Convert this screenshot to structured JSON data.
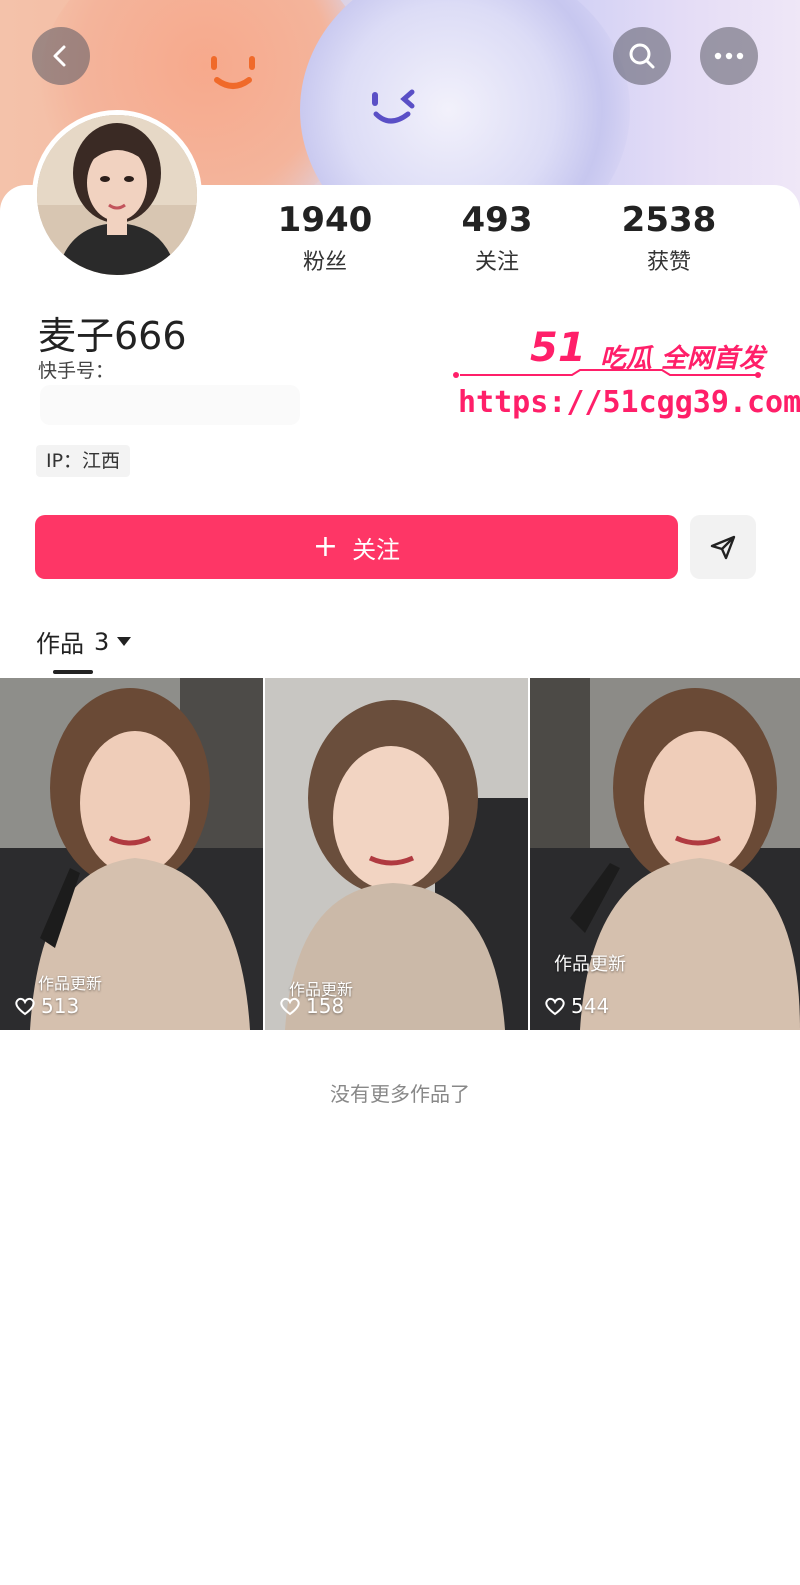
{
  "profile": {
    "nickname": "麦子666",
    "kuaishou_id_label": "快手号",
    "ip_label": "IP：江西"
  },
  "stats": [
    {
      "value": "1940",
      "label": "粉丝"
    },
    {
      "value": "493",
      "label": "关注"
    },
    {
      "value": "2538",
      "label": "获赞"
    }
  ],
  "actions": {
    "follow_label": "关注",
    "follow_icon": "plus-icon",
    "share_icon": "send-icon"
  },
  "header_icons": [
    "back-icon",
    "search-icon",
    "more-icon"
  ],
  "watermark": {
    "brand_number": "51",
    "brand_text": "吃瓜 全网首发",
    "url": "https://51cgg39.com"
  },
  "tabs": {
    "works_label": "作品",
    "works_count": "3"
  },
  "videos": [
    {
      "label": "作品更新",
      "likes": "513"
    },
    {
      "label": "作品更新",
      "likes": "158"
    },
    {
      "label": "作品更新",
      "likes": "544"
    }
  ],
  "footer": {
    "no_more": "没有更多作品了"
  },
  "colors": {
    "accent": "#fe3666",
    "watermark": "#ff1f69"
  }
}
